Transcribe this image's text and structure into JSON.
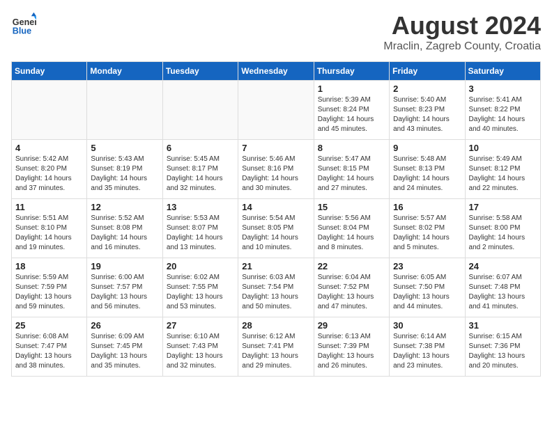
{
  "header": {
    "logo_general": "General",
    "logo_blue": "Blue",
    "month_title": "August 2024",
    "location": "Mraclin, Zagreb County, Croatia"
  },
  "days_of_week": [
    "Sunday",
    "Monday",
    "Tuesday",
    "Wednesday",
    "Thursday",
    "Friday",
    "Saturday"
  ],
  "weeks": [
    [
      {
        "day": "",
        "content": ""
      },
      {
        "day": "",
        "content": ""
      },
      {
        "day": "",
        "content": ""
      },
      {
        "day": "",
        "content": ""
      },
      {
        "day": "1",
        "content": "Sunrise: 5:39 AM\nSunset: 8:24 PM\nDaylight: 14 hours\nand 45 minutes."
      },
      {
        "day": "2",
        "content": "Sunrise: 5:40 AM\nSunset: 8:23 PM\nDaylight: 14 hours\nand 43 minutes."
      },
      {
        "day": "3",
        "content": "Sunrise: 5:41 AM\nSunset: 8:22 PM\nDaylight: 14 hours\nand 40 minutes."
      }
    ],
    [
      {
        "day": "4",
        "content": "Sunrise: 5:42 AM\nSunset: 8:20 PM\nDaylight: 14 hours\nand 37 minutes."
      },
      {
        "day": "5",
        "content": "Sunrise: 5:43 AM\nSunset: 8:19 PM\nDaylight: 14 hours\nand 35 minutes."
      },
      {
        "day": "6",
        "content": "Sunrise: 5:45 AM\nSunset: 8:17 PM\nDaylight: 14 hours\nand 32 minutes."
      },
      {
        "day": "7",
        "content": "Sunrise: 5:46 AM\nSunset: 8:16 PM\nDaylight: 14 hours\nand 30 minutes."
      },
      {
        "day": "8",
        "content": "Sunrise: 5:47 AM\nSunset: 8:15 PM\nDaylight: 14 hours\nand 27 minutes."
      },
      {
        "day": "9",
        "content": "Sunrise: 5:48 AM\nSunset: 8:13 PM\nDaylight: 14 hours\nand 24 minutes."
      },
      {
        "day": "10",
        "content": "Sunrise: 5:49 AM\nSunset: 8:12 PM\nDaylight: 14 hours\nand 22 minutes."
      }
    ],
    [
      {
        "day": "11",
        "content": "Sunrise: 5:51 AM\nSunset: 8:10 PM\nDaylight: 14 hours\nand 19 minutes."
      },
      {
        "day": "12",
        "content": "Sunrise: 5:52 AM\nSunset: 8:08 PM\nDaylight: 14 hours\nand 16 minutes."
      },
      {
        "day": "13",
        "content": "Sunrise: 5:53 AM\nSunset: 8:07 PM\nDaylight: 14 hours\nand 13 minutes."
      },
      {
        "day": "14",
        "content": "Sunrise: 5:54 AM\nSunset: 8:05 PM\nDaylight: 14 hours\nand 10 minutes."
      },
      {
        "day": "15",
        "content": "Sunrise: 5:56 AM\nSunset: 8:04 PM\nDaylight: 14 hours\nand 8 minutes."
      },
      {
        "day": "16",
        "content": "Sunrise: 5:57 AM\nSunset: 8:02 PM\nDaylight: 14 hours\nand 5 minutes."
      },
      {
        "day": "17",
        "content": "Sunrise: 5:58 AM\nSunset: 8:00 PM\nDaylight: 14 hours\nand 2 minutes."
      }
    ],
    [
      {
        "day": "18",
        "content": "Sunrise: 5:59 AM\nSunset: 7:59 PM\nDaylight: 13 hours\nand 59 minutes."
      },
      {
        "day": "19",
        "content": "Sunrise: 6:00 AM\nSunset: 7:57 PM\nDaylight: 13 hours\nand 56 minutes."
      },
      {
        "day": "20",
        "content": "Sunrise: 6:02 AM\nSunset: 7:55 PM\nDaylight: 13 hours\nand 53 minutes."
      },
      {
        "day": "21",
        "content": "Sunrise: 6:03 AM\nSunset: 7:54 PM\nDaylight: 13 hours\nand 50 minutes."
      },
      {
        "day": "22",
        "content": "Sunrise: 6:04 AM\nSunset: 7:52 PM\nDaylight: 13 hours\nand 47 minutes."
      },
      {
        "day": "23",
        "content": "Sunrise: 6:05 AM\nSunset: 7:50 PM\nDaylight: 13 hours\nand 44 minutes."
      },
      {
        "day": "24",
        "content": "Sunrise: 6:07 AM\nSunset: 7:48 PM\nDaylight: 13 hours\nand 41 minutes."
      }
    ],
    [
      {
        "day": "25",
        "content": "Sunrise: 6:08 AM\nSunset: 7:47 PM\nDaylight: 13 hours\nand 38 minutes."
      },
      {
        "day": "26",
        "content": "Sunrise: 6:09 AM\nSunset: 7:45 PM\nDaylight: 13 hours\nand 35 minutes."
      },
      {
        "day": "27",
        "content": "Sunrise: 6:10 AM\nSunset: 7:43 PM\nDaylight: 13 hours\nand 32 minutes."
      },
      {
        "day": "28",
        "content": "Sunrise: 6:12 AM\nSunset: 7:41 PM\nDaylight: 13 hours\nand 29 minutes."
      },
      {
        "day": "29",
        "content": "Sunrise: 6:13 AM\nSunset: 7:39 PM\nDaylight: 13 hours\nand 26 minutes."
      },
      {
        "day": "30",
        "content": "Sunrise: 6:14 AM\nSunset: 7:38 PM\nDaylight: 13 hours\nand 23 minutes."
      },
      {
        "day": "31",
        "content": "Sunrise: 6:15 AM\nSunset: 7:36 PM\nDaylight: 13 hours\nand 20 minutes."
      }
    ]
  ]
}
